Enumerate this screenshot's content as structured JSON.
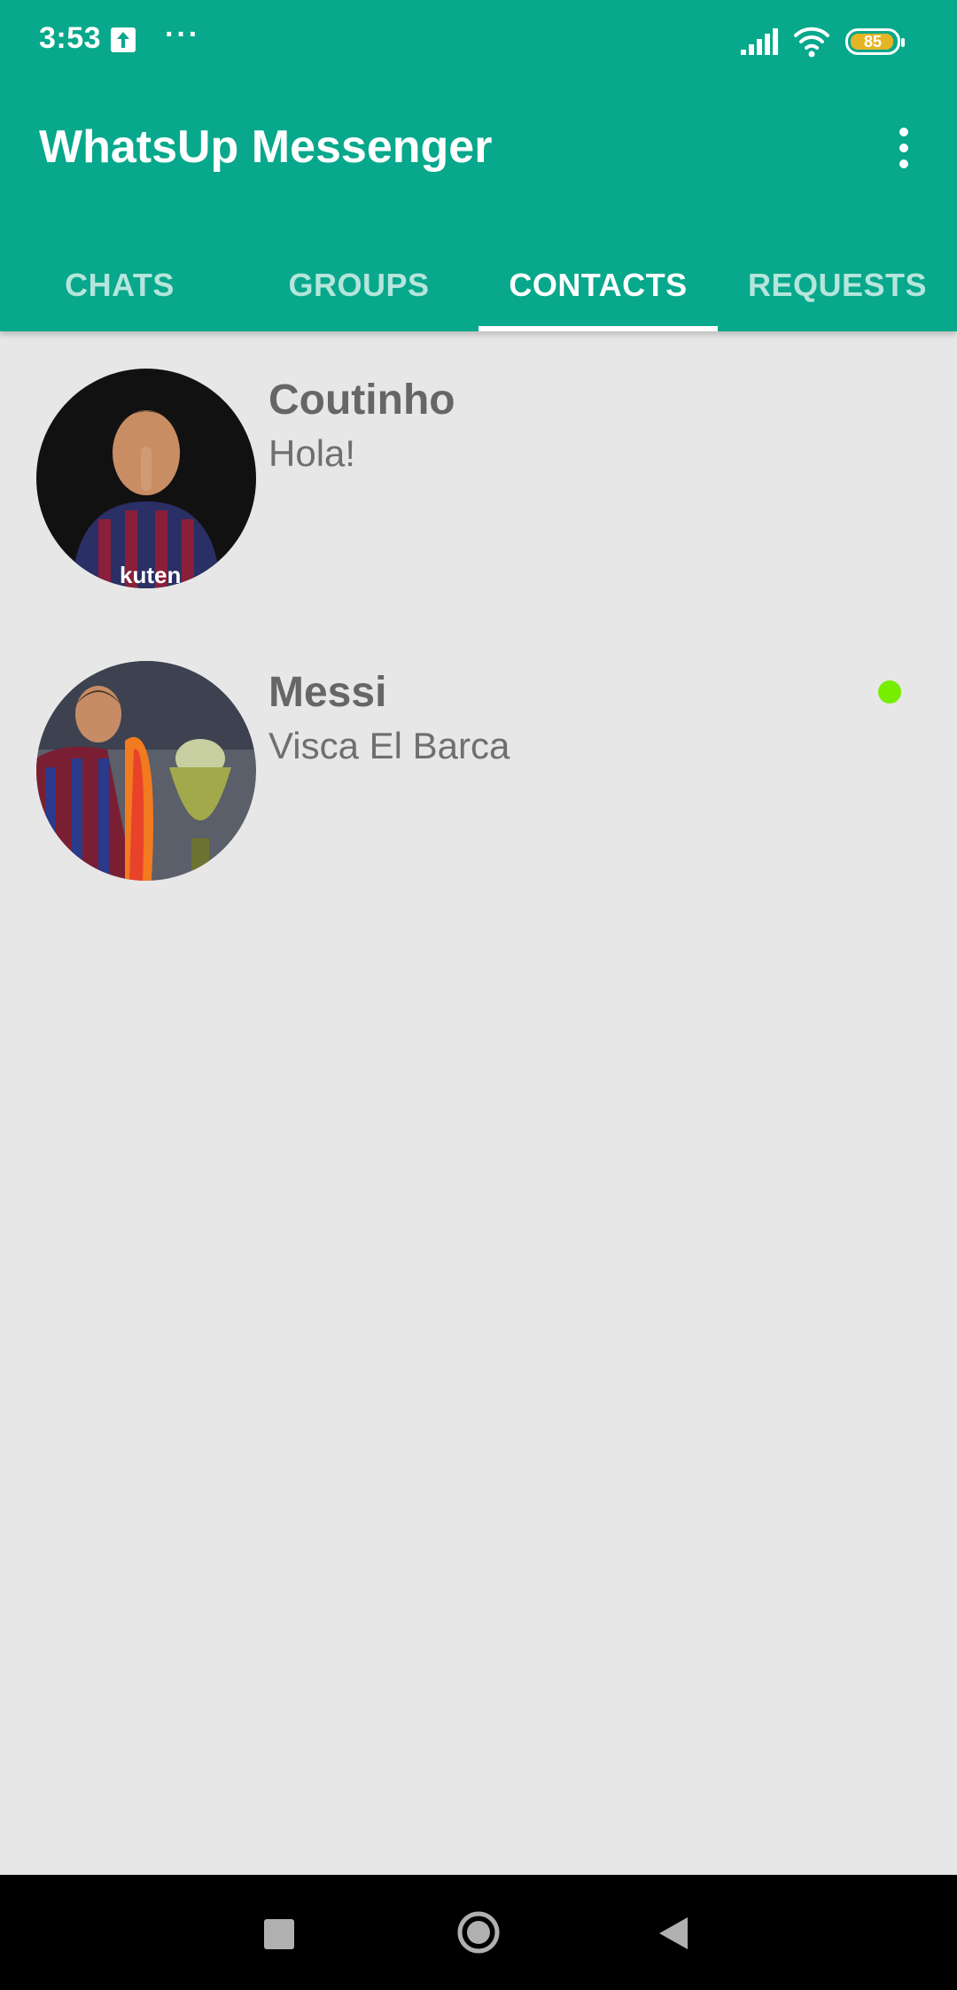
{
  "status_bar": {
    "time": "3:53",
    "more": "···",
    "battery": "85",
    "icons": [
      "upload-icon",
      "signal-icon",
      "wifi-icon",
      "battery-icon"
    ]
  },
  "app": {
    "title": "WhatsUp Messenger",
    "menu_icon": "more-vert-icon"
  },
  "tabs": [
    {
      "label": "CHATS",
      "active": false
    },
    {
      "label": "GROUPS",
      "active": false
    },
    {
      "label": "CONTACTS",
      "active": true
    },
    {
      "label": "REQUESTS",
      "active": false
    }
  ],
  "contacts": [
    {
      "name": "Coutinho",
      "status": "Hola!",
      "online": false
    },
    {
      "name": "Messi",
      "status": "Visca El Barca",
      "online": true
    }
  ],
  "colors": {
    "primary": "#07a88b",
    "background": "#e7e7e7",
    "online": "#76ee00",
    "battery": "#e6b526"
  },
  "nav_bar": {
    "icons": [
      "recent-apps-icon",
      "home-icon",
      "back-icon"
    ]
  }
}
